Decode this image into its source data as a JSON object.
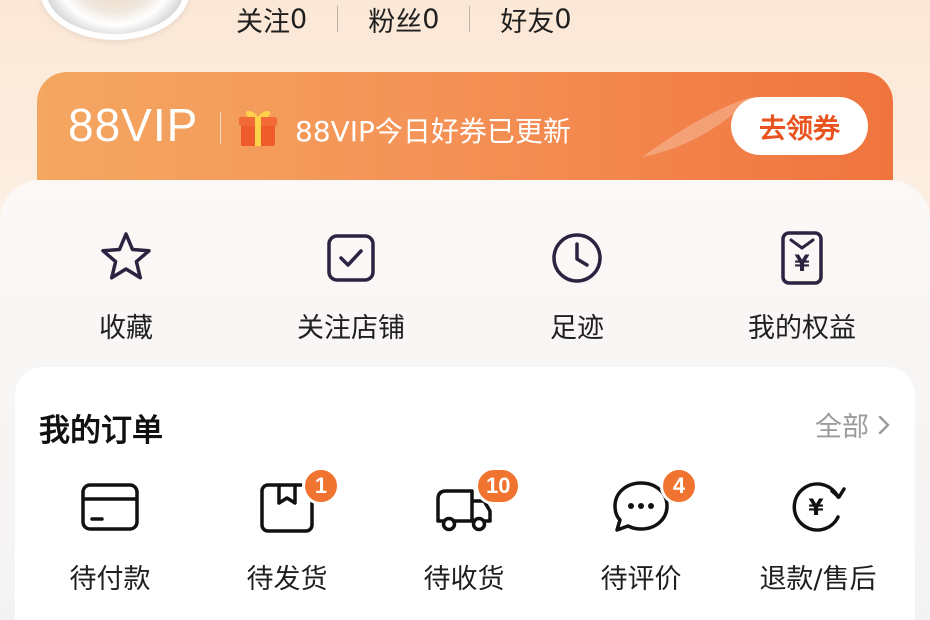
{
  "profile": {
    "following_label": "关注",
    "following_count": "0",
    "fans_label": "粉丝",
    "fans_count": "0",
    "friends_label": "好友",
    "friends_count": "0"
  },
  "vip_banner": {
    "logo": "88VIP",
    "message": "88VIP今日好券已更新",
    "button_label": "去领券",
    "accent_color": "#f0743e"
  },
  "quick_links": [
    {
      "label": "收藏",
      "icon": "star-icon"
    },
    {
      "label": "关注店铺",
      "icon": "store-check-icon"
    },
    {
      "label": "足迹",
      "icon": "clock-icon"
    },
    {
      "label": "我的权益",
      "icon": "yen-coupon-icon"
    }
  ],
  "orders": {
    "title": "我的订单",
    "view_all_label": "全部",
    "items": [
      {
        "label": "待付款",
        "icon": "card-icon",
        "badge": ""
      },
      {
        "label": "待发货",
        "icon": "package-icon",
        "badge": "1"
      },
      {
        "label": "待收货",
        "icon": "truck-icon",
        "badge": "10"
      },
      {
        "label": "待评价",
        "icon": "chat-icon",
        "badge": "4"
      },
      {
        "label": "退款/售后",
        "icon": "yen-refund-icon",
        "badge": ""
      }
    ]
  }
}
